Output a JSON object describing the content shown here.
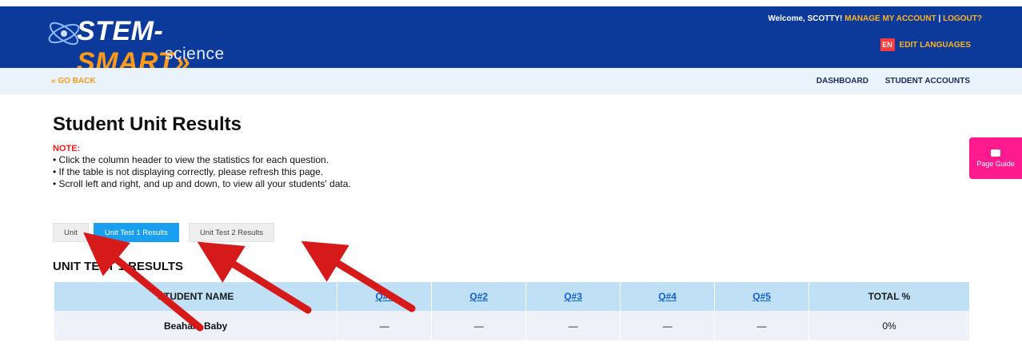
{
  "header": {
    "logo_stem": "STEM-",
    "logo_smart": "SMART»",
    "logo_science": "science",
    "welcome_text": "Welcome, SCOTTY!",
    "manage_account": "MANAGE MY ACCOUNT",
    "separator": "|",
    "logout": "LOGOUT?",
    "lang_badge": "EN",
    "edit_languages": "EDIT LANGUAGES"
  },
  "subnav": {
    "go_back": "« GO BACK",
    "links": [
      "DASHBOARD",
      "STUDENT ACCOUNTS"
    ]
  },
  "page": {
    "title": "Student Unit Results",
    "note_label": "NOTE:",
    "notes": [
      "Click the column header to view the statistics for each question.",
      "If the table is not displaying correctly, please refresh this page.",
      "Scroll left and right, and up and down, to view all your students' data."
    ]
  },
  "tabs": [
    "Unit",
    "Unit Test 1 Results",
    "Unit Test 2 Results"
  ],
  "section_title": "UNIT TEST 1 RESULTS",
  "table": {
    "headers": [
      "STUDENT NAME",
      "Q#1",
      "Q#2",
      "Q#3",
      "Q#4",
      "Q#5",
      "TOTAL %"
    ],
    "rows": [
      [
        "Beahan, Baby",
        "—",
        "—",
        "—",
        "—",
        "—",
        "0%"
      ]
    ]
  },
  "page_guide": {
    "label": "Page Guide"
  },
  "colors": {
    "header_bg": "#0b3a9a",
    "accent_orange": "#ff9a1a",
    "tab_active": "#1a9ef0",
    "note_red": "#ff1a1a",
    "page_guide": "#ff1b8d",
    "annotation_arrow": "#d61a1a"
  }
}
